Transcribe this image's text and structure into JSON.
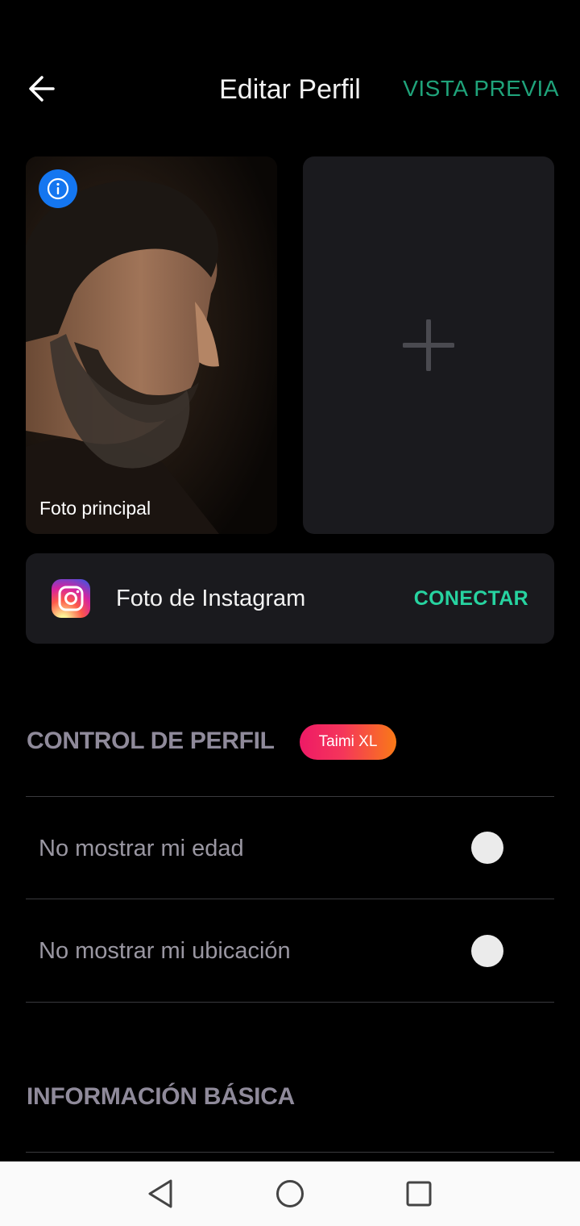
{
  "header": {
    "title": "Editar Perfil",
    "preview_label": "VISTA PREVIA"
  },
  "photos": {
    "main_caption": "Foto principal"
  },
  "instagram": {
    "label": "Foto de Instagram",
    "action": "CONECTAR"
  },
  "profile_control": {
    "title": "CONTROL DE PERFIL",
    "badge": "Taimi XL",
    "toggles": [
      {
        "label": "No mostrar mi edad",
        "on": false
      },
      {
        "label": "No mostrar mi ubicación",
        "on": false
      }
    ]
  },
  "basic_info": {
    "title": "INFORMACIÓN BÁSICA"
  },
  "colors": {
    "accent": "#1fa37a",
    "connect": "#27d3a0",
    "info": "#1476f0"
  }
}
